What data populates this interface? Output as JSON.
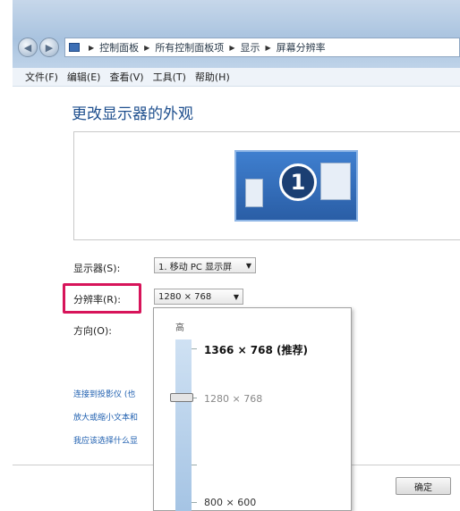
{
  "address": {
    "crumbs": [
      "控制面板",
      "所有控制面板项",
      "显示",
      "屏幕分辨率"
    ],
    "back_icon": "back-arrow-icon",
    "forward_icon": "forward-arrow-icon"
  },
  "menu": [
    "文件(F)",
    "编辑(E)",
    "查看(V)",
    "工具(T)",
    "帮助(H)"
  ],
  "title": "更改显示器的外观",
  "preview": {
    "monitor_number": "1"
  },
  "fields": {
    "display_label": "显示器(S):",
    "display_value": "1. 移动 PC 显示屏",
    "resolution_label": "分辨率(R):",
    "resolution_value": "1280 × 768",
    "orientation_label": "方向(O):"
  },
  "links": [
    "连接到投影仪 (也",
    "放大或缩小文本和",
    "我应该选择什么显"
  ],
  "dropdown": {
    "high_label": "高",
    "options": [
      {
        "label": "1366 × 768 (推荐)",
        "state": "recommended"
      },
      {
        "label": "1280 × 768",
        "state": "selected"
      },
      {
        "label": "800 × 600",
        "state": "lowest"
      }
    ]
  },
  "buttons": {
    "ok": "确定"
  },
  "colors": {
    "title": "#1e4f8e",
    "highlight": "#d7145a",
    "link": "#2060b0"
  }
}
